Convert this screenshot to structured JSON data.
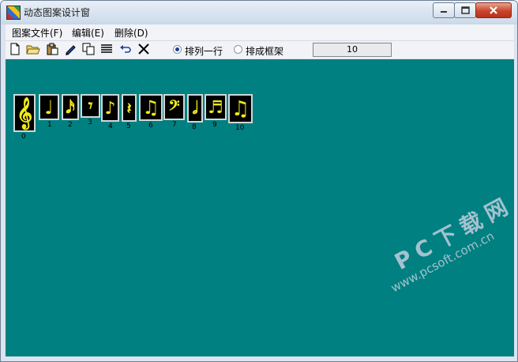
{
  "window": {
    "title": "动态图案设计窗",
    "min_icon": "minimize-icon",
    "max_icon": "maximize-icon",
    "close_icon": "close-icon"
  },
  "menu": [
    "图案文件(F)",
    "编辑(E)",
    "删除(D)"
  ],
  "toolbar": {
    "icons": [
      "new-file-icon",
      "open-folder-icon",
      "paste-icon",
      "pen-icon",
      "copy-icon",
      "list-icon",
      "undo-icon",
      "delete-icon"
    ],
    "radio1_label": "排列一行",
    "radio2_label": "排成框架",
    "count_value": "10",
    "selected_radio": "排列一行"
  },
  "canvas": {
    "background": "#008080",
    "symbols": [
      {
        "glyph": "𝄞",
        "index": "0"
      },
      {
        "glyph": "♩",
        "index": "1"
      },
      {
        "glyph": "𝅘𝅥𝅯",
        "index": "2"
      },
      {
        "glyph": "𝄾",
        "index": "3"
      },
      {
        "glyph": "♪",
        "index": "4"
      },
      {
        "glyph": "𝄽",
        "index": "5"
      },
      {
        "glyph": "♫",
        "index": "6"
      },
      {
        "glyph": "𝄢",
        "index": "7"
      },
      {
        "glyph": "𝅗𝅥",
        "index": "8"
      },
      {
        "glyph": "♬",
        "index": "9"
      },
      {
        "glyph": "♫",
        "index": "10"
      }
    ]
  },
  "watermark": {
    "line1": "PC下载网",
    "line2": "www.pcsoft.com.cn"
  }
}
